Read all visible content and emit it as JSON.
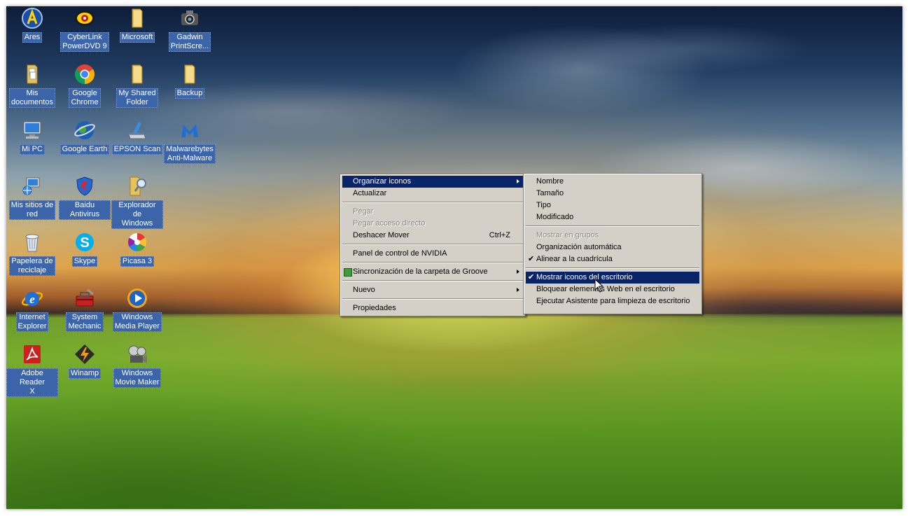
{
  "desktop_icons": [
    {
      "label": "Ares",
      "icon": "ares-icon"
    },
    {
      "label": "CyberLink\nPowerDVD 9",
      "icon": "powerdvd-icon"
    },
    {
      "label": "Microsoft",
      "icon": "folder-icon"
    },
    {
      "label": "Gadwin\nPrintScre...",
      "icon": "camera-icon"
    },
    {
      "label": "Mis\ndocumentos",
      "icon": "documents-folder-icon"
    },
    {
      "label": "Google\nChrome",
      "icon": "chrome-icon"
    },
    {
      "label": "My Shared\nFolder",
      "icon": "folder-icon"
    },
    {
      "label": "Backup",
      "icon": "folder-icon"
    },
    {
      "label": "Mi PC",
      "icon": "computer-icon"
    },
    {
      "label": "Google Earth",
      "icon": "google-earth-icon"
    },
    {
      "label": "EPSON Scan",
      "icon": "scanner-icon"
    },
    {
      "label": "Malwarebytes\nAnti-Malware",
      "icon": "malwarebytes-icon"
    },
    {
      "label": "Mis sitios de\nred",
      "icon": "network-icon"
    },
    {
      "label": "Baidu Antivirus",
      "icon": "shield-icon"
    },
    {
      "label": "Explorador de\nWindows",
      "icon": "explorer-folder-icon"
    },
    {
      "label": "Papelera de\nreciclaje",
      "icon": "recycle-bin-icon"
    },
    {
      "label": "Skype",
      "icon": "skype-icon"
    },
    {
      "label": "Picasa 3",
      "icon": "picasa-icon"
    },
    {
      "label": "Internet\nExplorer",
      "icon": "internet-explorer-icon"
    },
    {
      "label": "System\nMechanic",
      "icon": "toolbox-icon"
    },
    {
      "label": "Windows\nMedia Player",
      "icon": "media-player-icon"
    },
    {
      "label": "Adobe Reader\nX",
      "icon": "adobe-reader-icon"
    },
    {
      "label": "Winamp",
      "icon": "winamp-icon"
    },
    {
      "label": "Windows\nMovie Maker",
      "icon": "movie-maker-icon"
    }
  ],
  "context_menu": {
    "organize": "Organizar iconos",
    "refresh": "Actualizar",
    "paste": "Pegar",
    "paste_shortcut": "Pegar acceso directo",
    "undo_move": "Deshacer Mover",
    "undo_shortcut": "Ctrl+Z",
    "nvidia": "Panel de control de NVIDIA",
    "groove_sync": "Sincronización de la carpeta de Groove",
    "new": "Nuevo",
    "properties": "Propiedades"
  },
  "submenu": {
    "name": "Nombre",
    "size": "Tamaño",
    "type": "Tipo",
    "modified": "Modificado",
    "show_in_groups": "Mostrar en grupos",
    "auto_arrange": "Organización automática",
    "align_grid": "Alinear a la cuadrícula",
    "show_desktop_icons": "Mostrar iconos del escritorio",
    "lock_web_items": "Bloquear elementos Web en el escritorio",
    "cleanup_wizard": "Ejecutar Asistente para limpieza de escritorio"
  },
  "colors": {
    "icon_label_bg": "#3b64a9",
    "menu_bg": "#d4d0c8",
    "menu_highlight": "#0a246a"
  }
}
